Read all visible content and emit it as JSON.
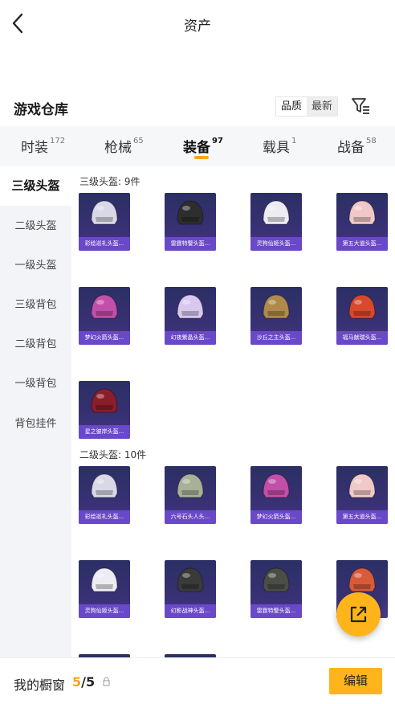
{
  "header": {
    "title": "资产",
    "back_icon": "chevron-left-icon"
  },
  "warehouse": {
    "title": "游戏仓库",
    "sort_options": [
      "品质",
      "最新"
    ],
    "sort_selected": "最新",
    "filter_icon": "filter-icon"
  },
  "tabs": [
    {
      "label": "时装",
      "count": "172",
      "active": false
    },
    {
      "label": "枪械",
      "count": "65",
      "active": false
    },
    {
      "label": "装备",
      "count": "97",
      "active": true
    },
    {
      "label": "载具",
      "count": "1",
      "active": false
    },
    {
      "label": "战备",
      "count": "58",
      "active": false
    }
  ],
  "sidebar": {
    "items": [
      "三级头盔",
      "二级头盔",
      "一级头盔",
      "三级背包",
      "二级背包",
      "一级背包",
      "背包挂件"
    ],
    "active_index": 0
  },
  "sections": [
    {
      "title": "三级头盔: 9件",
      "items": [
        {
          "name": "彩绘巡礼头盔...",
          "color": "#d8d8e6"
        },
        {
          "name": "雷霆特警头盔...",
          "color": "#2e2e2e"
        },
        {
          "name": "灵狗仙姬头盔...",
          "color": "#ececf2"
        },
        {
          "name": "第五大道头盔...",
          "color": "#f0c8c8"
        },
        {
          "name": "梦幻火箭头盔...",
          "color": "#c24fa8"
        },
        {
          "name": "幻夜紫晶头盔...",
          "color": "#d8c8f0"
        },
        {
          "name": "沙丘之主头盔...",
          "color": "#b08a4a"
        },
        {
          "name": "福马献瑞头盔...",
          "color": "#d8482c"
        },
        {
          "name": "星之彼岸头盔...",
          "color": "#8a1e2a"
        }
      ]
    },
    {
      "title": "二级头盔: 10件",
      "items": [
        {
          "name": "彩绘巡礼头盔...",
          "color": "#d8d8e6"
        },
        {
          "name": "六号石头人头...",
          "color": "#a8b098"
        },
        {
          "name": "梦幻火箭头盔...",
          "color": "#c24fa8"
        },
        {
          "name": "第五大道头盔...",
          "color": "#f0c8c8"
        },
        {
          "name": "灵狗仙姬头盔...",
          "color": "#ececf2"
        },
        {
          "name": "幻影战神头盔...",
          "color": "#3a3a3a"
        },
        {
          "name": "雷霆特警头盔...",
          "color": "#4a4e44"
        },
        {
          "name": "",
          "color": "#d85a3a"
        }
      ]
    }
  ],
  "fab": {
    "icon": "share-icon"
  },
  "bottom": {
    "label": "我的橱窗",
    "count_current": "5",
    "count_sep": "/",
    "count_total": "5",
    "lock_icon": "lock-icon",
    "edit_label": "编辑"
  }
}
